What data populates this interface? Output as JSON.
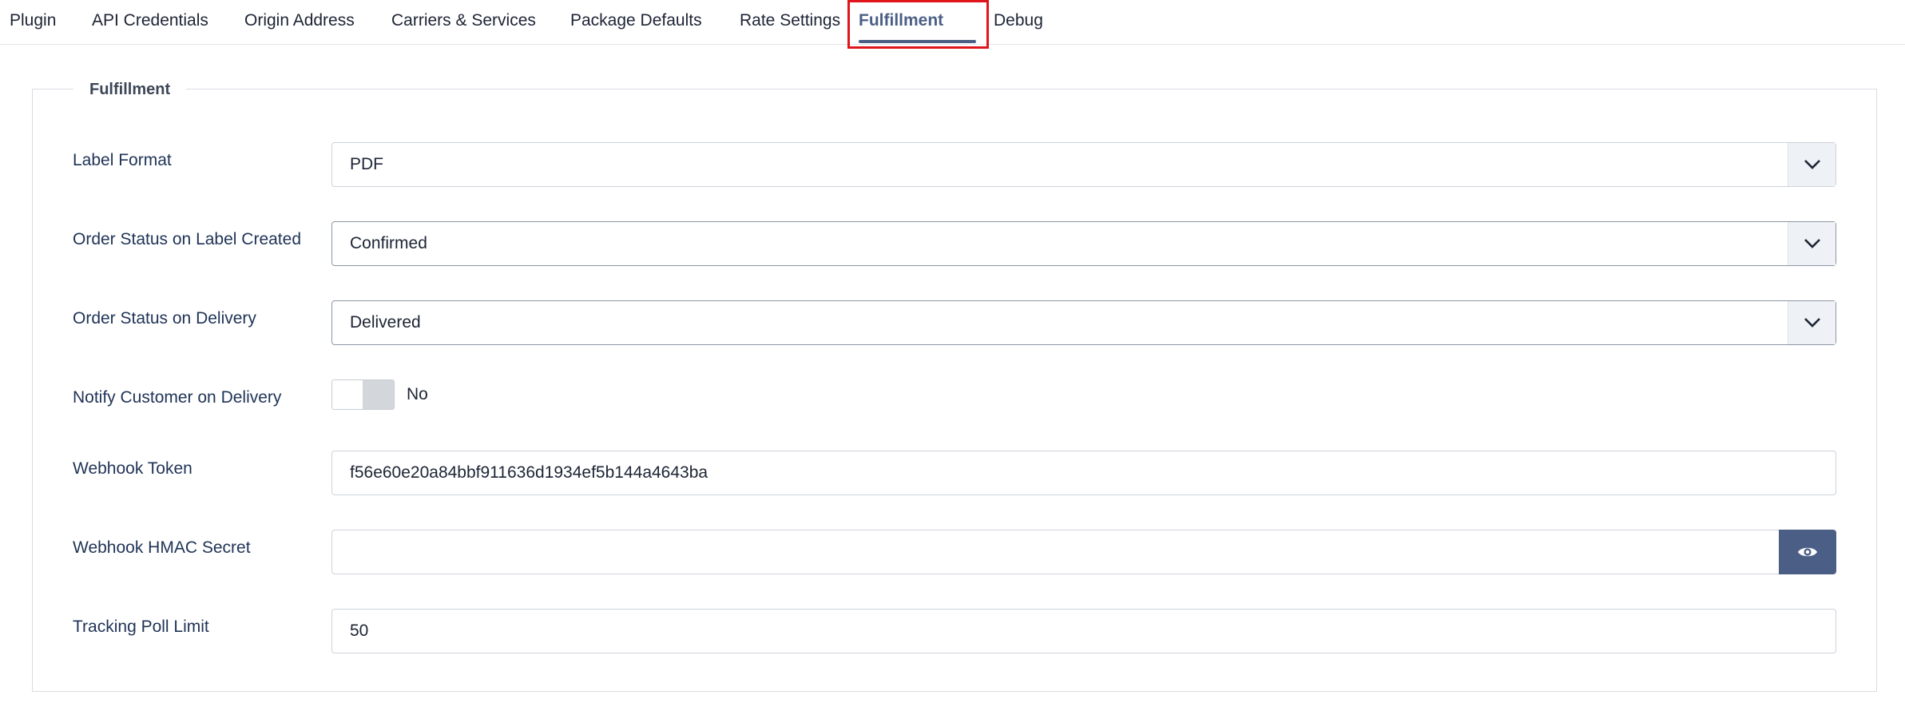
{
  "tabs": [
    {
      "label": "Plugin"
    },
    {
      "label": "API Credentials"
    },
    {
      "label": "Origin Address"
    },
    {
      "label": "Carriers & Services"
    },
    {
      "label": "Package Defaults"
    },
    {
      "label": "Rate Settings"
    },
    {
      "label": "Fulfillment",
      "active": true
    },
    {
      "label": "Debug"
    }
  ],
  "section": {
    "legend": "Fulfillment"
  },
  "fields": {
    "label_format": {
      "label": "Label Format",
      "value": "PDF"
    },
    "order_status_label_created": {
      "label": "Order Status on Label Created",
      "value": "Confirmed"
    },
    "order_status_delivery": {
      "label": "Order Status on Delivery",
      "value": "Delivered"
    },
    "notify_customer": {
      "label": "Notify Customer on Delivery",
      "value": "No",
      "enabled": false
    },
    "webhook_token": {
      "label": "Webhook Token",
      "value": "f56e60e20a84bbf911636d1934ef5b144a4643ba"
    },
    "webhook_hmac_secret": {
      "label": "Webhook HMAC Secret",
      "value": ""
    },
    "tracking_poll_limit": {
      "label": "Tracking Poll Limit",
      "value": "50"
    }
  },
  "icons": {
    "select_arrow": "chevron-down-icon",
    "reveal": "eye-icon"
  },
  "colors": {
    "accent": "#4b5f86",
    "highlight": "#e0151c"
  }
}
